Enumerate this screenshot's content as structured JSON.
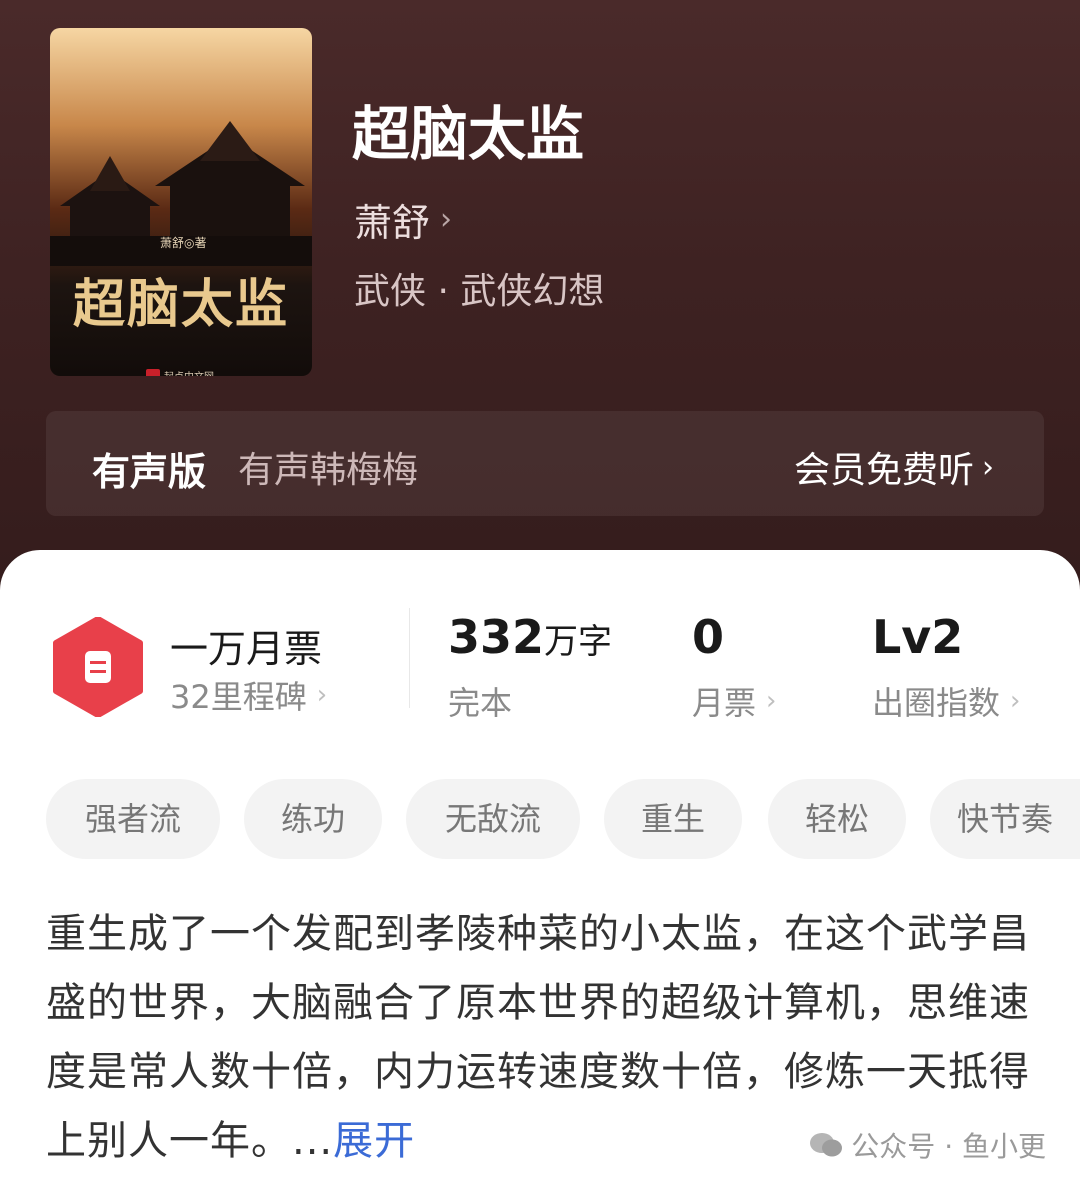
{
  "book": {
    "cover": {
      "title_art": "超脑太监",
      "author_small": "萧舒◎著",
      "publisher": "起点中文网"
    },
    "title": "超脑太监",
    "author": "萧舒",
    "genre": "武侠 · 武侠幻想"
  },
  "audio": {
    "label": "有声版",
    "narrator": "有声韩梅梅",
    "action": "会员免费听"
  },
  "stats": {
    "milestone": {
      "title": "一万月票",
      "sub": "32里程碑"
    },
    "words": {
      "value": "332",
      "unit": "万字",
      "sub": "完本"
    },
    "monthly_votes": {
      "value": "0",
      "sub": "月票"
    },
    "popularity": {
      "value": "Lv2",
      "sub": "出圈指数"
    }
  },
  "tags": [
    "强者流",
    "练功",
    "无敌流",
    "重生",
    "轻松",
    "快节奏"
  ],
  "intro": {
    "text": "重生成了一个发配到孝陵种菜的小太监，在这个武学昌盛的世界，大脑融合了原本世界的超级计算机，思维速度是常人数十倍，内力运转速度数十倍，修炼一天抵得上别人一年。",
    "ellipsis": "...",
    "expand": "展开"
  },
  "watermark": "公众号 · 鱼小更",
  "colors": {
    "header_bg": "#3e2222",
    "accent_red": "#e8404a",
    "link_blue": "#3b6bd6"
  }
}
